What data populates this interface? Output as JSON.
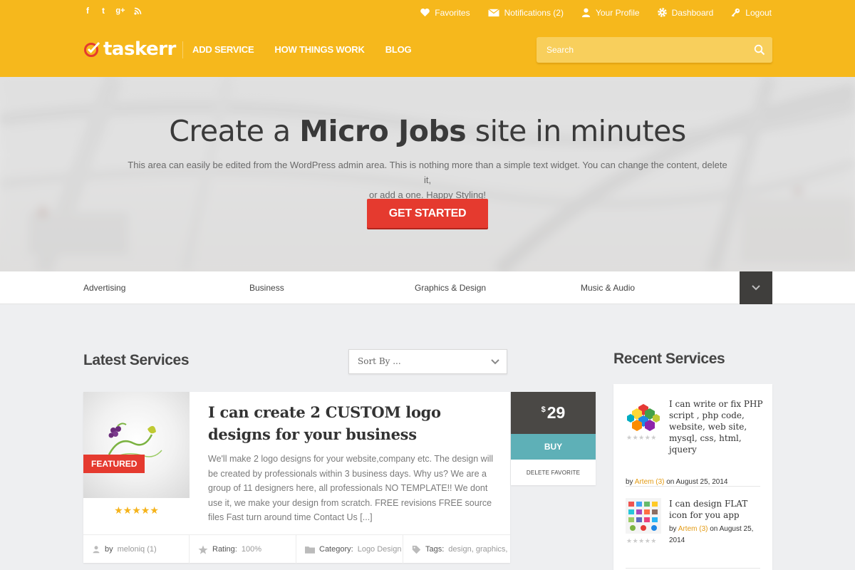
{
  "header": {
    "social_icons": [
      "facebook-icon",
      "twitter-icon",
      "google-plus-icon",
      "rss-icon"
    ],
    "social_glyphs": {
      "facebook": "f",
      "twitter": "t",
      "google": "g+",
      "rss": "◠"
    },
    "top_links": {
      "favorites": "Favorites",
      "notifications": "Notifications (2)",
      "profile": "Your Profile",
      "dashboard": "Dashboard",
      "logout": "Logout"
    },
    "logo_text": "taskerr",
    "nav": {
      "add_service": "ADD SERVICE",
      "how_things_work": "HOW THINGS WORK",
      "blog": "BLOG"
    },
    "search_placeholder": "Search",
    "brand_color": "#f6b81c"
  },
  "hero": {
    "title_prefix": "Create a ",
    "title_bold": "Micro Jobs",
    "title_suffix": " site in minutes",
    "description_line1": "This area can easily be edited from the WordPress admin area. This is nothing more than a simple text widget. You can change the content, delete it,",
    "description_line2": "or add a one. Happy Styling!",
    "button": "GET STARTED",
    "button_color": "#e53a2f"
  },
  "categories": {
    "items": [
      "Advertising",
      "Business",
      "Graphics & Design",
      "Music & Audio"
    ],
    "toggle_icon": "chevron-down-icon"
  },
  "latest": {
    "title": "Latest Services",
    "sort_placeholder": "Sort By ...",
    "card": {
      "badge": "FEATURED",
      "stars": "★★★★★",
      "rating_value": 5,
      "title": "I can create 2 CUSTOM logo designs for your business",
      "description": "We'll make 2 logo designs for your website,company etc. The design will be created by professionals within 3 business days.   Why us? We are a group of 11 designers here, all professionals NO TEMPLATE!! We dont use it, we make your design from scratch. FREE revisions FREE source files Fast turn around time Contact Us [...]",
      "meta": {
        "by_label": "by",
        "author": "meloniq (1)",
        "rating_label": "Rating:",
        "rating": "100%",
        "category_label": "Category:",
        "category": "Logo Design",
        "tags_label": "Tags:",
        "tags": "design, graphics,"
      },
      "price_currency": "$",
      "price_amount": "29",
      "buy": "BUY",
      "delete_favorite": "DELETE FAVORITE"
    }
  },
  "recent": {
    "title": "Recent Services",
    "items": [
      {
        "title": "I can write or fix PHP script , php code, website, web site, mysql, css, html, jquery",
        "stars": "★★★★★",
        "by": "by",
        "author": "Artem (3)",
        "date": "on August 25, 2014"
      },
      {
        "title": "I can design FLAT icon for you app",
        "stars": "★★★★★",
        "by": "by",
        "author": "Artem (3)",
        "date": "on August 25, 2014"
      }
    ]
  }
}
